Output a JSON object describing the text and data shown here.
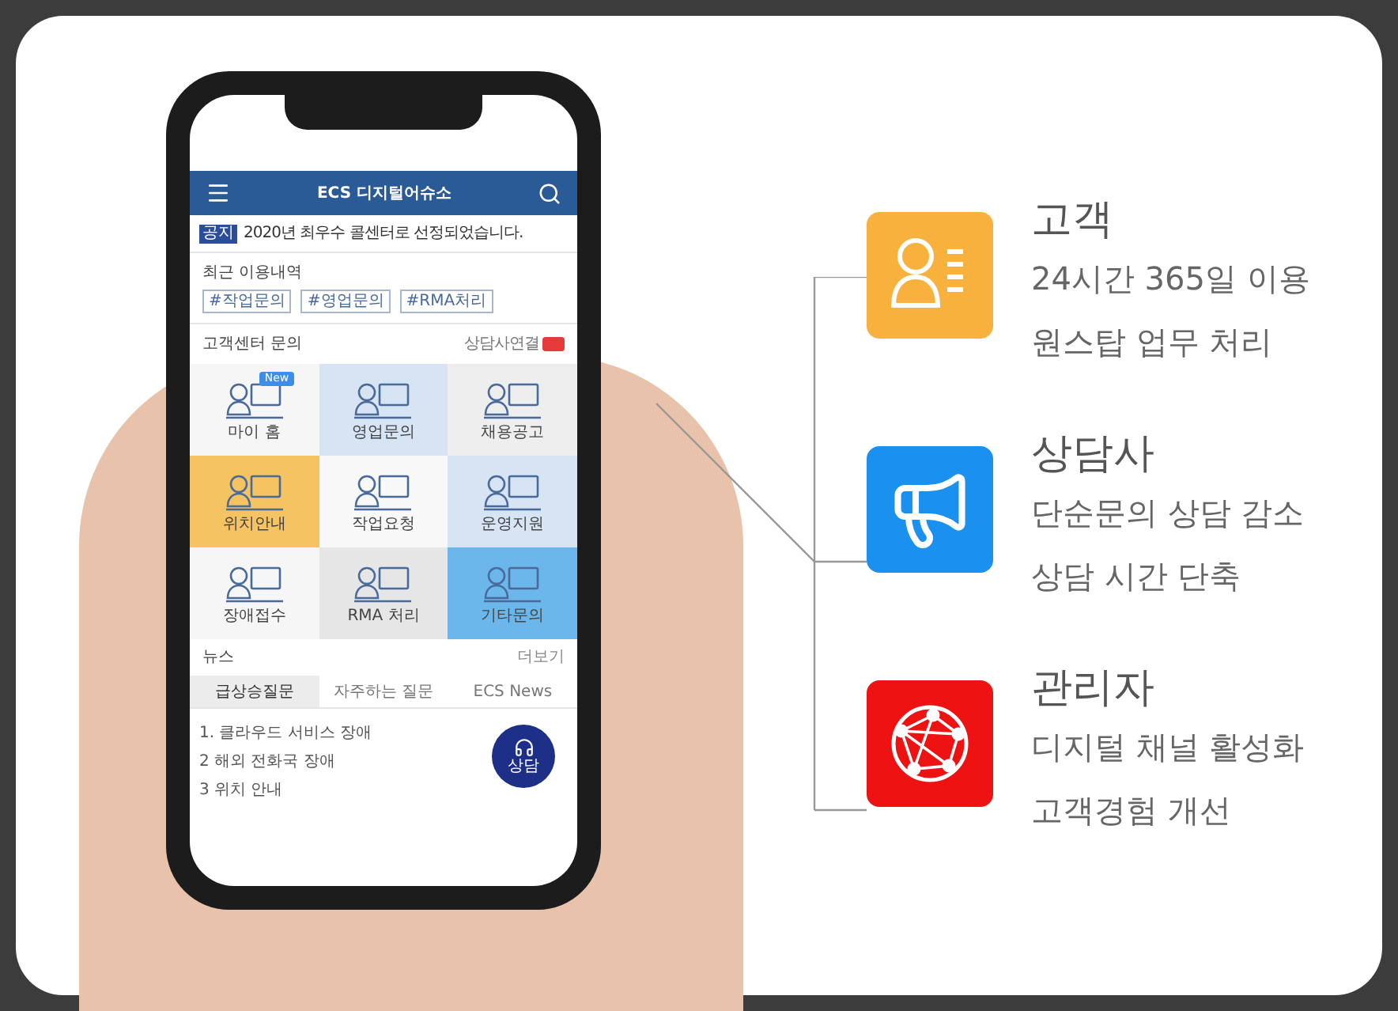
{
  "phone_app": {
    "logo_text": "ECS 디지털어슈소",
    "notice": {
      "badge": "공지",
      "text": "2020년 최우수 콜센터로 선정되었습니다."
    },
    "recent": {
      "title": "최근 이용내역",
      "tags": [
        "#작업문의",
        "#영업문의",
        "#RMA처리"
      ]
    },
    "inquiry": {
      "title": "고객센터 문의",
      "status_label": "상담사연결",
      "tiles": [
        {
          "label": "마이 홈",
          "color": "#f6f6f6",
          "badge": "New"
        },
        {
          "label": "영업문의",
          "color": "#d6e4f4"
        },
        {
          "label": "채용공고",
          "color": "#eeeeee"
        },
        {
          "label": "위치안내",
          "color": "#f5c361"
        },
        {
          "label": "작업요청",
          "color": "#f8f8f8"
        },
        {
          "label": "운영지원",
          "color": "#d6e4f4"
        },
        {
          "label": "장애접수",
          "color": "#f6f6f6"
        },
        {
          "label": "RMA 처리",
          "color": "#e6e6e6"
        },
        {
          "label": "기타문의",
          "color": "#6bb6ea"
        }
      ]
    },
    "news": {
      "title": "뉴스",
      "more": "더보기",
      "tabs": [
        {
          "label": "급상승질문",
          "selected": true
        },
        {
          "label": "자주하는 질문",
          "selected": false
        },
        {
          "label": "ECS News",
          "selected": false
        }
      ],
      "items": [
        "1. 클라우드 서비스 장애",
        "2 해외 전화국 장애",
        "3 위치 안내"
      ]
    },
    "consult_button": "상담"
  },
  "features": [
    {
      "kind": "customer",
      "color": "#f7b13c",
      "title": "고객",
      "lines": [
        "24시간 365일 이용",
        "원스탑 업무 처리"
      ]
    },
    {
      "kind": "agent",
      "color": "#1a90ef",
      "title": "상담사",
      "lines": [
        "단순문의 상담 감소",
        "상담 시간 단축"
      ]
    },
    {
      "kind": "admin",
      "color": "#ee1212",
      "title": "관리자",
      "lines": [
        "디지털 채널 활성화",
        "고객경험 개선"
      ]
    }
  ]
}
